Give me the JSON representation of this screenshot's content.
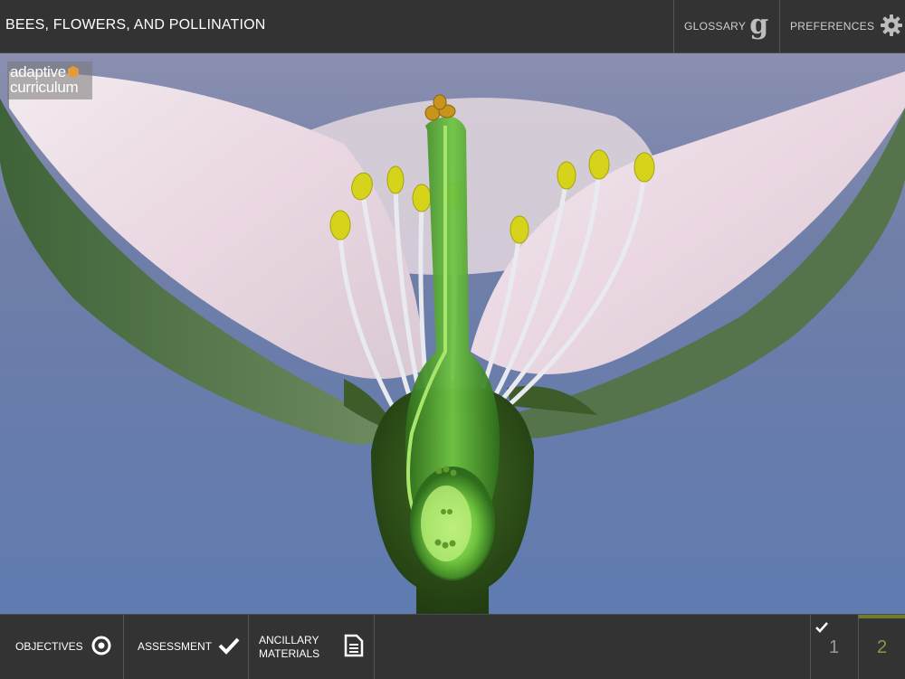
{
  "header": {
    "title": "BEES, FLOWERS, AND POLLINATION",
    "glossary_label": "GLOSSARY",
    "glossary_glyph": "g",
    "preferences_label": "PREFERENCES"
  },
  "logo": {
    "line1": "adaptive",
    "line2": "curriculum",
    "accent": "#e79b36"
  },
  "footer": {
    "objectives_label": "OBJECTIVES",
    "assessment_label": "ASSESSMENT",
    "ancillary_line1": "ANCILLARY",
    "ancillary_line2": "MATERIALS",
    "pages": [
      {
        "number": "1",
        "completed": true
      },
      {
        "number": "2",
        "current": true
      }
    ],
    "active_color": "#8e9a45"
  },
  "icons": [
    "g-icon",
    "gear-icon",
    "target-icon",
    "checkmark-icon",
    "document-icon"
  ]
}
